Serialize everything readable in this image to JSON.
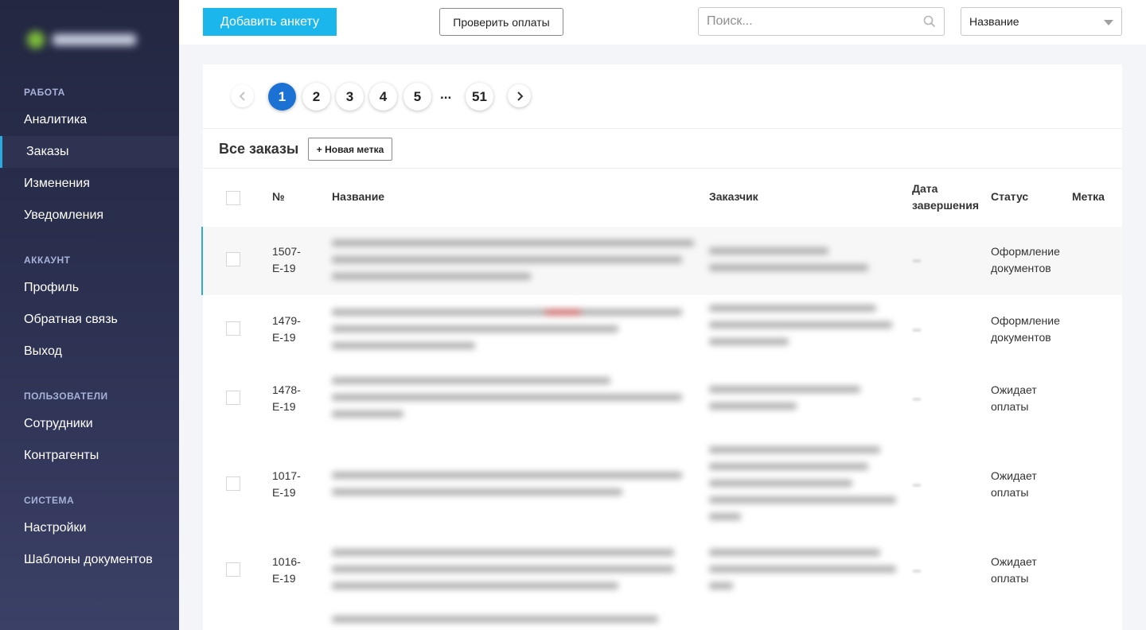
{
  "sidebar": {
    "sections": [
      {
        "title": "РАБОТА",
        "items": [
          "Аналитика",
          "Заказы",
          "Изменения",
          "Уведомления"
        ]
      },
      {
        "title": "АККАУНТ",
        "items": [
          "Профиль",
          "Обратная связь",
          "Выход"
        ]
      },
      {
        "title": "ПОЛЬЗОВАТЕЛИ",
        "items": [
          "Сотрудники",
          "Контрагенты"
        ]
      },
      {
        "title": "СИСТЕМА",
        "items": [
          "Настройки",
          "Шаблоны документов"
        ]
      }
    ],
    "active_item": "Заказы"
  },
  "header": {
    "add_button": "Добавить анкету",
    "check_button": "Проверить оплаты",
    "search_placeholder": "Поиск...",
    "sort_value": "Название"
  },
  "pagination": {
    "pages": [
      "1",
      "2",
      "3",
      "4",
      "5"
    ],
    "ellipsis": "...",
    "last": "51",
    "current": "1"
  },
  "orders": {
    "title": "Все заказы",
    "new_tag_button": "+ Новая метка",
    "columns": {
      "number": "№",
      "name": "Название",
      "customer": "Заказчик",
      "date_line1": "Дата",
      "date_line2": "завершения",
      "status": "Статус",
      "tag": "Метка"
    },
    "rows": [
      {
        "num1": "1507-",
        "num2": "E-19",
        "status1": "Оформление",
        "status2": "документов"
      },
      {
        "num1": "1479-",
        "num2": "E-19",
        "status1": "Оформление",
        "status2": "документов"
      },
      {
        "num1": "1478-",
        "num2": "E-19",
        "status1": "Ожидает",
        "status2": "оплаты"
      },
      {
        "num1": "1017-",
        "num2": "E-19",
        "status1": "Ожидает",
        "status2": "оплаты"
      },
      {
        "num1": "1016-",
        "num2": "E-19",
        "status1": "Ожидает",
        "status2": "оплаты"
      }
    ]
  },
  "colors": {
    "sidebar_bg": "#232741",
    "accent": "#1bb7ec",
    "page_active": "#1c72d4"
  }
}
